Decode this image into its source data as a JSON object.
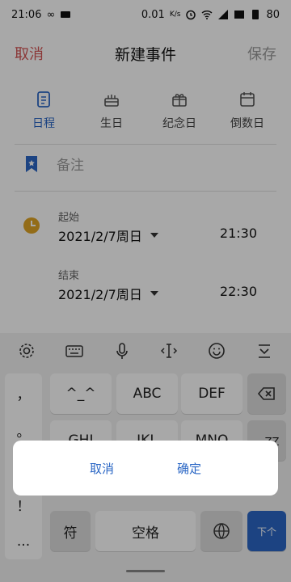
{
  "status_bar": {
    "time": "21:06",
    "speed": "0.01",
    "speed_unit": "K/s",
    "battery": "80"
  },
  "titlebar": {
    "cancel": "取消",
    "title": "新建事件",
    "save": "保存"
  },
  "event_types": [
    {
      "label": "日程",
      "icon": "document-icon"
    },
    {
      "label": "生日",
      "icon": "cake-icon"
    },
    {
      "label": "纪念日",
      "icon": "gift-icon"
    },
    {
      "label": "倒数日",
      "icon": "calendar-icon"
    }
  ],
  "note": {
    "placeholder": "备注"
  },
  "start": {
    "label": "起始",
    "date": "2021/2/7周日",
    "time": "21:30"
  },
  "end": {
    "label": "结束",
    "date": "2021/2/7周日",
    "time": "22:30"
  },
  "keyboard": {
    "toolbar_icons": [
      "gear-icon",
      "keyboard-icon",
      "microphone-icon",
      "cursor-icon",
      "emoji-icon",
      "collapse-keyboard-icon"
    ],
    "side_keys": [
      "，",
      "。",
      "？",
      "！",
      "..."
    ],
    "row1": [
      "^_^",
      "ABC",
      "DEF"
    ],
    "row2": [
      "GHI",
      "JKL",
      "MNO",
      "。ZZ"
    ],
    "symbol_key": "符",
    "space_key": "空格",
    "enter_key": "下个"
  },
  "dialog": {
    "cancel": "取消",
    "confirm": "确定"
  },
  "colors": {
    "accent_blue": "#2b67c5",
    "cancel_red": "#d35454",
    "clock_yellow": "#e0a525"
  }
}
